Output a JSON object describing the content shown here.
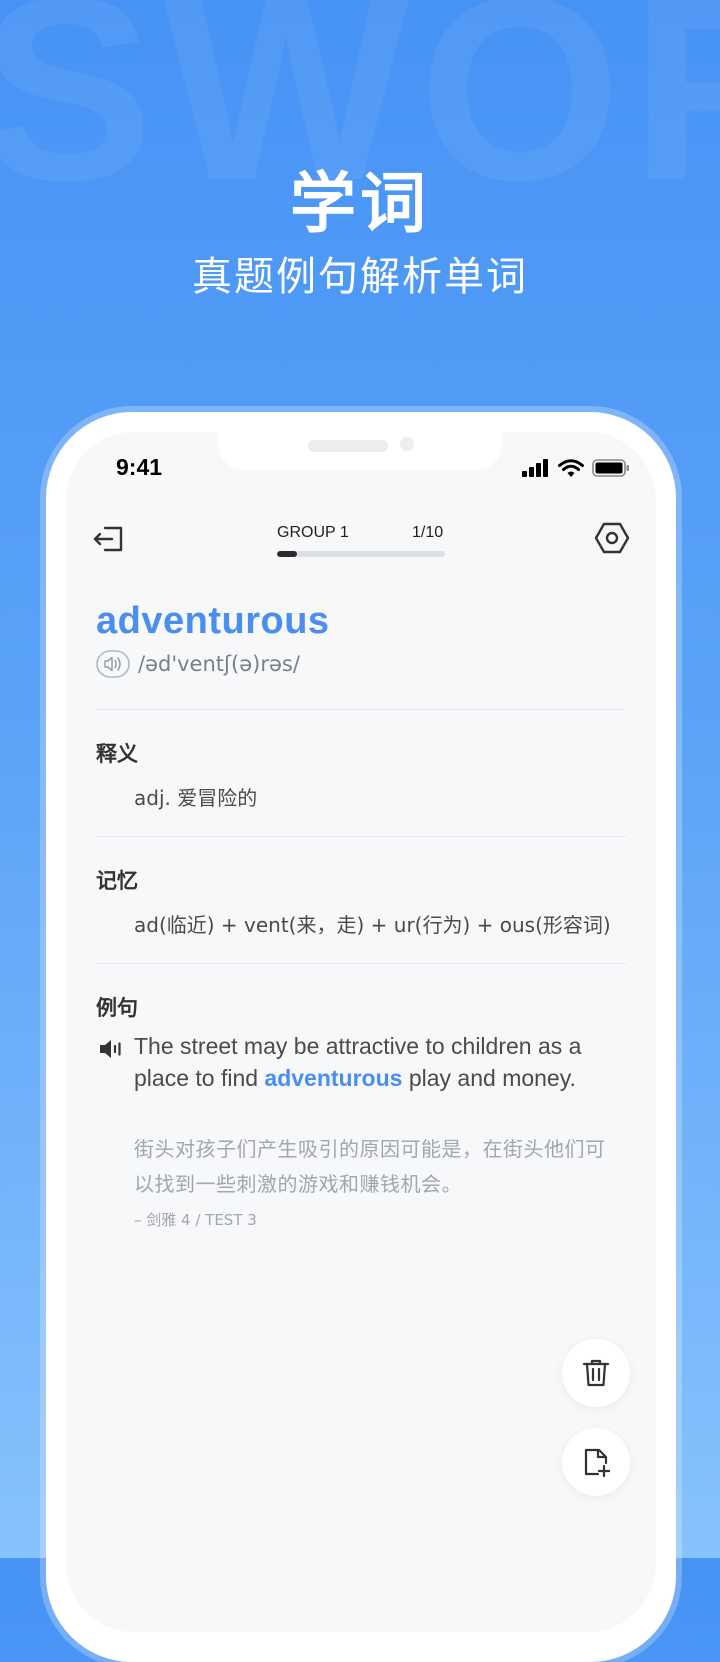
{
  "promo": {
    "watermark": "SWORD",
    "title": "学词",
    "subtitle": "真题例句解析单词"
  },
  "status_bar": {
    "time": "9:41"
  },
  "top_bar": {
    "group_label": "GROUP 1",
    "group_count": "1/10",
    "progress": 0.12
  },
  "word": {
    "text": "adventurous",
    "phonetic": "/əd'ventʃ(ə)rəs/"
  },
  "sections": {
    "definition": {
      "title": "释义",
      "content": "adj. 爱冒险的"
    },
    "memory": {
      "title": "记忆",
      "content": "ad(临近) + vent(来，走) + ur(行为) + ous(形容词)"
    },
    "example": {
      "title": "例句",
      "sentence_before": "The street may be attractive to children as a place to find ",
      "sentence_highlight": "adventurous",
      "sentence_after": " play and money.",
      "translation": "街头对孩子们产生吸引的原因可能是，在街头他们可以找到一些刺激的游戏和赚钱机会。",
      "source": "– 剑雅 4 / TEST 3"
    }
  },
  "colors": {
    "accent": "#4a8ef0",
    "background_top": "#4793f5",
    "background_bottom": "#86c2fc"
  },
  "icons": {
    "back": "exit-icon",
    "settings": "hexagon-settings-icon",
    "pronounce": "speaker-icon",
    "delete": "trash-icon",
    "add": "file-add-icon"
  }
}
